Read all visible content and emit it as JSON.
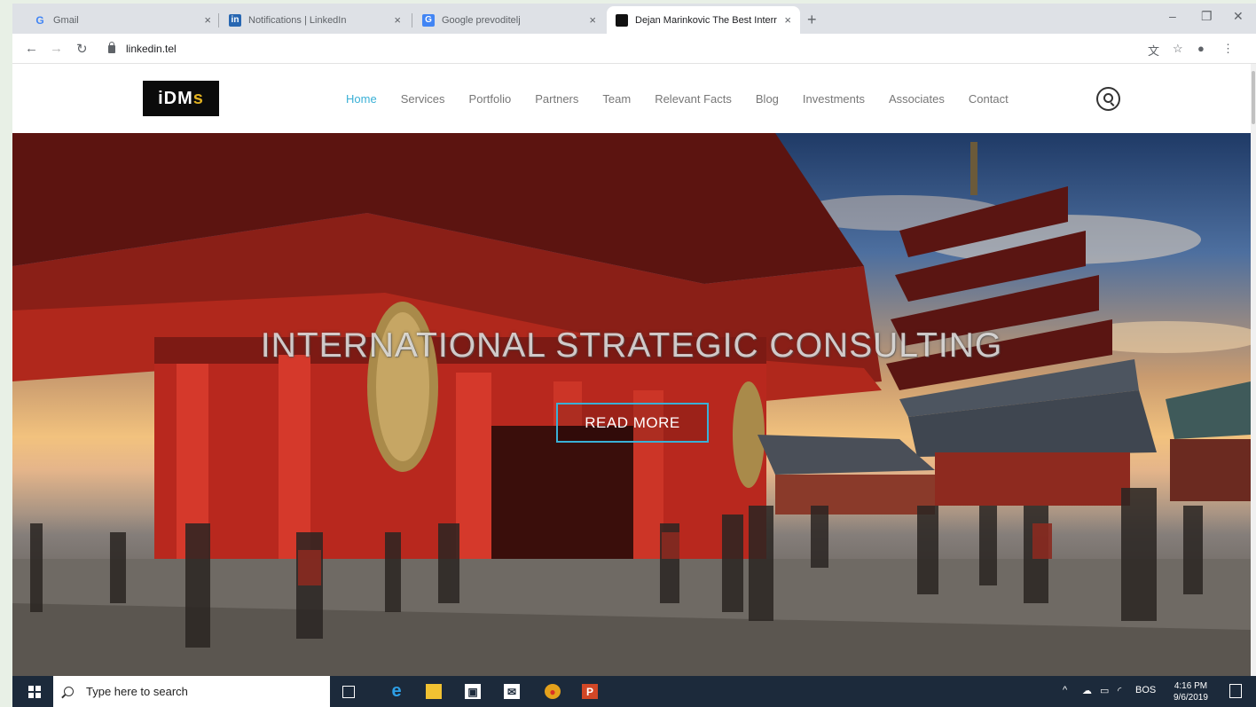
{
  "browser": {
    "tabs": [
      {
        "label": "Gmail",
        "icon": "gmail-icon"
      },
      {
        "label": "Notifications | LinkedIn",
        "icon": "linkedin-icon"
      },
      {
        "label": "Google prevoditelj",
        "icon": "google-translate-icon"
      },
      {
        "label": "Dejan Marinkovic The Best Interr",
        "icon": "idms-favicon",
        "active": true
      }
    ],
    "url": "linkedin.tel"
  },
  "site": {
    "logo_main": "iDM",
    "logo_accent": "s",
    "nav": [
      "Home",
      "Services",
      "Portfolio",
      "Partners",
      "Team",
      "Relevant Facts",
      "Blog",
      "Investments",
      "Associates",
      "Contact"
    ],
    "active_nav": "Home",
    "accent_color": "#3ab0d6"
  },
  "hero": {
    "title": "INTERNATIONAL STRATEGIC CONSULTING",
    "button": "READ MORE"
  },
  "taskbar": {
    "search_placeholder": "Type here to search",
    "language": "BOS",
    "time": "4:16 PM",
    "date": "9/6/2019"
  }
}
